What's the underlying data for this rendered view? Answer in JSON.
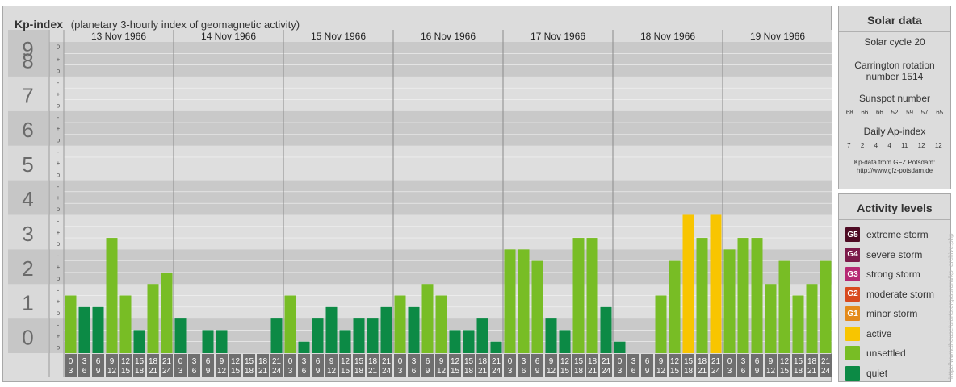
{
  "title": {
    "main": "Kp-index",
    "sub": "(planetary 3-hourly index of geomagnetic activity)"
  },
  "colors": {
    "quiet": "#0c8a45",
    "unsettled": "#78bd25",
    "active": "#f8c500",
    "g1": "#e48a1a",
    "g2": "#d84a1e",
    "g3": "#b62873",
    "g4": "#7c1a4a",
    "g5": "#4e0b24"
  },
  "chart_data": {
    "type": "bar",
    "ylabel": "",
    "ylim": [
      0,
      9
    ],
    "y_major_ticks": [
      "0",
      "1",
      "2",
      "3",
      "4",
      "5",
      "6",
      "7",
      "8",
      "9"
    ],
    "y_minor_ticks": [
      "o",
      "+",
      "-"
    ],
    "days": [
      "13 Nov 1966",
      "14 Nov 1966",
      "15 Nov 1966",
      "16 Nov 1966",
      "17 Nov 1966",
      "18 Nov 1966",
      "19 Nov 1966"
    ],
    "hour_starts": [
      "0",
      "3",
      "6",
      "9",
      "12",
      "15",
      "18",
      "21"
    ],
    "hour_ends": [
      "3",
      "6",
      "9",
      "12",
      "15",
      "18",
      "21",
      "24"
    ],
    "values": [
      [
        1.667,
        1.333,
        1.333,
        3.333,
        1.667,
        0.667,
        2.0,
        2.333
      ],
      [
        1.0,
        0.0,
        0.667,
        0.667,
        0.0,
        0.0,
        0.0,
        1.0
      ],
      [
        1.667,
        0.333,
        1.0,
        1.333,
        0.667,
        1.0,
        1.0,
        1.333
      ],
      [
        1.667,
        1.333,
        2.0,
        1.667,
        0.667,
        0.667,
        1.0,
        0.333
      ],
      [
        3.0,
        3.0,
        2.667,
        1.0,
        0.667,
        3.333,
        3.333,
        1.333
      ],
      [
        0.333,
        0.0,
        0.0,
        1.667,
        2.667,
        4.0,
        3.333,
        4.0
      ],
      [
        3.0,
        3.333,
        3.333,
        2.0,
        2.667,
        1.667,
        2.0,
        2.667
      ]
    ]
  },
  "solar": {
    "title": "Solar data",
    "cycle": "Solar cycle 20",
    "carrington_line1": "Carrington rotation",
    "carrington_line2": "number 1514",
    "sunspot_label": "Sunspot number",
    "sunspot_values": [
      "68",
      "66",
      "66",
      "52",
      "59",
      "57",
      "65"
    ],
    "ap_label": "Daily Ap-index",
    "ap_values": [
      "7",
      "2",
      "4",
      "4",
      "11",
      "12",
      "12"
    ],
    "credit_line1": "Kp-data from GFZ Potsdam:",
    "credit_line2": "http://www.gfz-potsdam.de"
  },
  "activity": {
    "title": "Activity levels",
    "items": [
      {
        "badge": "G5",
        "label": "extreme storm",
        "color": "#4e0b24"
      },
      {
        "badge": "G4",
        "label": "severe storm",
        "color": "#7c1a4a"
      },
      {
        "badge": "G3",
        "label": "strong storm",
        "color": "#b62873"
      },
      {
        "badge": "G2",
        "label": "moderate storm",
        "color": "#d84a1e"
      },
      {
        "badge": "G1",
        "label": "minor storm",
        "color": "#e48a1a"
      },
      {
        "badge": "",
        "label": "active",
        "color": "#f8c500"
      },
      {
        "badge": "",
        "label": "unsettled",
        "color": "#78bd25"
      },
      {
        "badge": "",
        "label": "quiet",
        "color": "#0c8a45"
      }
    ]
  },
  "watermark": "http://www.theusefularts.org/aurora/kp_archive.php"
}
